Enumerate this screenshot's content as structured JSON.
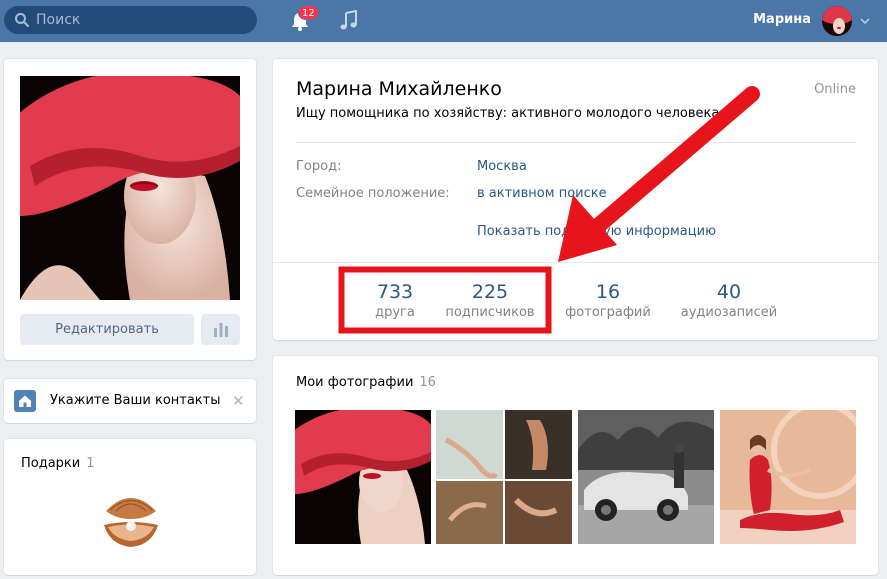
{
  "topbar": {
    "search_placeholder": "Поиск",
    "notifications_count": "12",
    "user_name": "Марина"
  },
  "sidebar": {
    "edit_button": "Редактировать",
    "contacts_prompt": "Укажите Ваши контакты",
    "gifts_title": "Подарки",
    "gifts_count": "1"
  },
  "profile": {
    "name": "Марина Михайленко",
    "status": "Ищу помощника по хозяйству: активного молодого человека",
    "online": "Online",
    "info": [
      {
        "label": "Город:",
        "value": "Москва"
      },
      {
        "label": "Семейное положение:",
        "value": "в активном поиске"
      }
    ],
    "show_more": "Показать подробную информацию",
    "counters": [
      {
        "num": "733",
        "label": "друга"
      },
      {
        "num": "225",
        "label": "подписчиков"
      },
      {
        "num": "16",
        "label": "фотографий"
      },
      {
        "num": "40",
        "label": "аудиозаписей"
      }
    ]
  },
  "photos": {
    "title": "Мои фотографии",
    "count": "16"
  },
  "colors": {
    "header_bg": "#4a76a8",
    "link": "#2a5885",
    "annotation_red": "#e8141b"
  },
  "icons": [
    "search-icon",
    "bell-icon",
    "music-icon",
    "chevron-down-icon",
    "stats-icon",
    "home-icon",
    "close-icon",
    "shell-gift-icon"
  ]
}
